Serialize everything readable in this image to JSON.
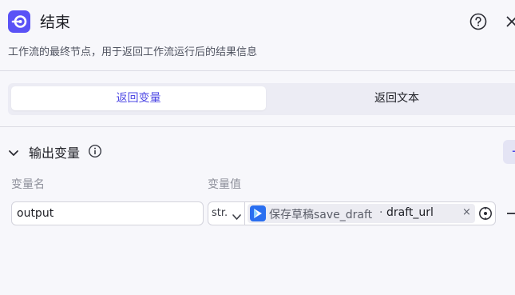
{
  "node": {
    "title": "结束",
    "description": "工作流的最终节点，用于返回工作流运行后的结果信息",
    "icon": "end-node-icon",
    "accent_color": "#5a52f6"
  },
  "header": {
    "help_icon": "question-circle-icon",
    "close_icon": "close-icon"
  },
  "tabs": [
    {
      "label": "返回变量",
      "active": true
    },
    {
      "label": "返回文本",
      "active": false
    }
  ],
  "output_section": {
    "title": "输出变量",
    "info_icon": "info-icon",
    "add_icon": "plus-icon",
    "columns": {
      "name": "变量名",
      "value": "变量值"
    },
    "rows": [
      {
        "name": "output",
        "type": "str.",
        "ref_node": "保存草稿save_draft",
        "ref_separator": "·",
        "ref_var": "draft_url",
        "clear_glyph": "×",
        "picker_icon": "variable-picker-icon",
        "remove_glyph": "—"
      }
    ]
  }
}
